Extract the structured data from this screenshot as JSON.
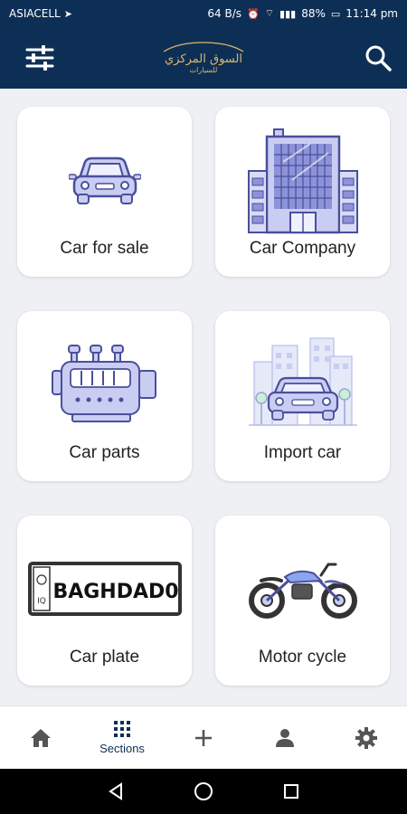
{
  "status_bar": {
    "carrier": "ASIACELL",
    "speed": "64 B/s",
    "battery": "88%",
    "time": "11:14 pm"
  },
  "header": {
    "logo_line1": "السوق المركزي",
    "logo_line2": "للسيارات"
  },
  "sections": [
    {
      "label": "Car for sale",
      "icon": "car-icon"
    },
    {
      "label": "Car Company",
      "icon": "building-icon"
    },
    {
      "label": "Car parts",
      "icon": "engine-icon"
    },
    {
      "label": "Import car",
      "icon": "import-car-icon"
    },
    {
      "label": "Car plate",
      "icon": "license-plate-icon",
      "plate_text": "BAGHDAD0",
      "plate_code": "IQ"
    },
    {
      "label": "Motor cycle",
      "icon": "motorcycle-icon"
    }
  ],
  "bottom_nav": {
    "sections_label": "Sections"
  },
  "colors": {
    "header_bg": "#0e2f55",
    "accent": "#0e2f55",
    "icon_fill": "#c9cdf2",
    "icon_stroke": "#4a4f9b",
    "logo_gold": "#d9b86a"
  }
}
